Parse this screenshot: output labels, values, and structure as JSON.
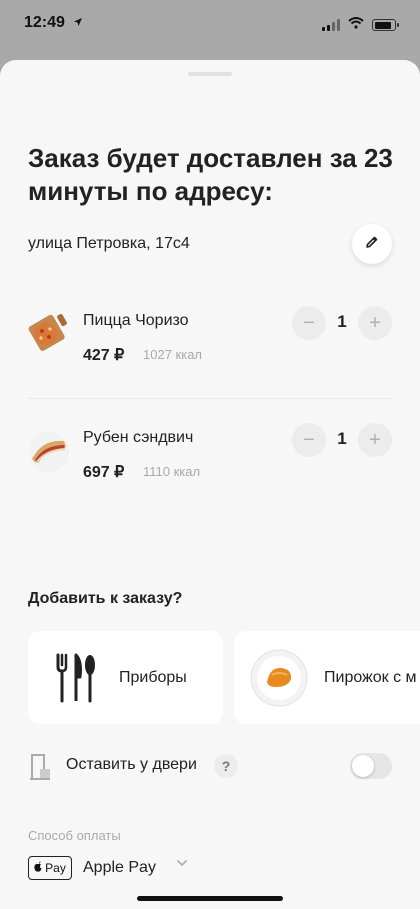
{
  "status_bar": {
    "time": "12:49",
    "location_icon": "location-arrow-icon"
  },
  "order": {
    "title": "Заказ будет доставлен за 23 минуты по адресу:",
    "address": "улица Петровка, 17с4",
    "edit_icon": "pencil-icon"
  },
  "items": [
    {
      "name": "Пицца Чоризо",
      "price": "427 ₽",
      "kcal": "1027 ккал",
      "quantity": "1",
      "minus": "−",
      "plus": "+"
    },
    {
      "name": "Рубен сэндвич",
      "price": "697 ₽",
      "kcal": "1110 ккал",
      "quantity": "1",
      "minus": "−",
      "plus": "+"
    }
  ],
  "addons": {
    "title": "Добавить к заказу?",
    "cards": [
      {
        "label": "Приборы",
        "icon": "cutlery-icon"
      },
      {
        "label": "Пирожок с м",
        "icon": "pie-icon"
      }
    ]
  },
  "door": {
    "label": "Оставить у двери",
    "help": "?",
    "toggle_on": false
  },
  "payment": {
    "caption": "Способ оплаты",
    "badge": "Pay",
    "method": "Apple Pay"
  },
  "colors": {
    "sheet_bg": "#f7f7f7",
    "overlay": "#a9a9a9",
    "muted_text": "#aaaaaa",
    "button_bg": "#ececec"
  }
}
